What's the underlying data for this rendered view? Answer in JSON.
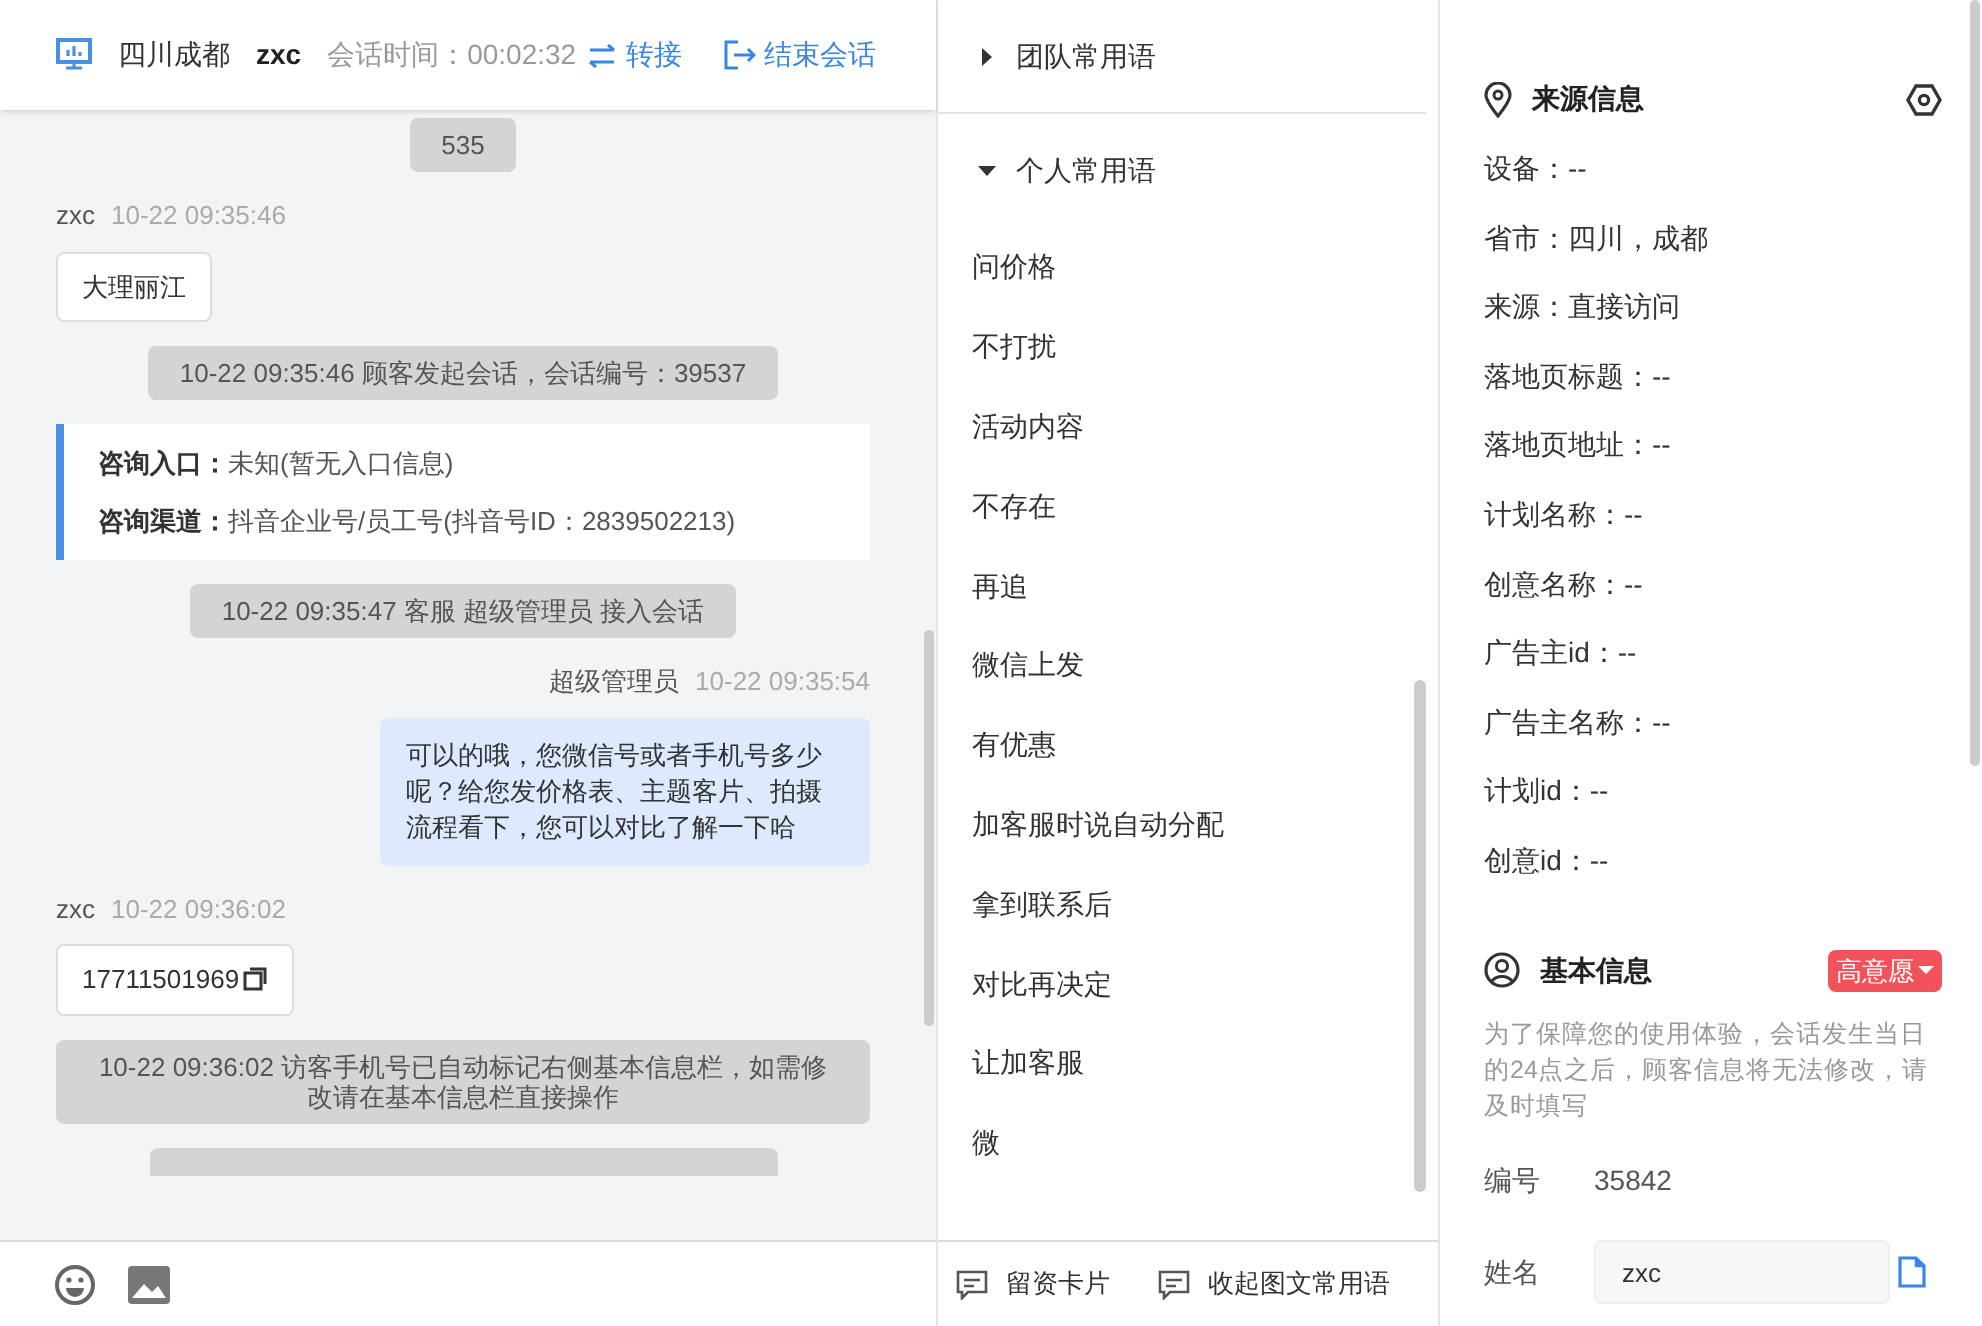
{
  "header": {
    "location": "四川成都",
    "user": "zxc",
    "session_time": "会话时间：00:02:32",
    "transfer": "转接",
    "end_session": "结束会话"
  },
  "messages": [
    {
      "kind": "system",
      "text": "535"
    },
    {
      "kind": "incoming",
      "sender": "zxc",
      "time": "10-22 09:35:46",
      "text": "大理丽江",
      "copyable": false
    },
    {
      "kind": "system",
      "text": "10-22 09:35:46 顾客发起会话，会话编号：39537"
    },
    {
      "kind": "info",
      "lines": [
        {
          "label": "咨询入口：",
          "value": "未知(暂无入口信息)"
        },
        {
          "label": "咨询渠道：",
          "value": "抖音企业号/员工号(抖音号ID：2839502213)"
        }
      ]
    },
    {
      "kind": "system",
      "text": "10-22 09:35:47 客服 超级管理员 接入会话"
    },
    {
      "kind": "outgoing",
      "sender": "超级管理员",
      "time": "10-22 09:35:54",
      "text": "可以的哦，您微信号或者手机号多少呢？给您发价格表、主题客片、拍摄流程看下，您可以对比了解一下哈"
    },
    {
      "kind": "incoming",
      "sender": "zxc",
      "time": "10-22 09:36:02",
      "text": "17711501969",
      "copyable": true
    },
    {
      "kind": "system",
      "text": "10-22 09:36:02 访客手机号已自动标记右侧基本信息栏，如需修改请在基本信息栏直接操作"
    },
    {
      "kind": "system"
    }
  ],
  "phrase_groups": [
    {
      "label": "团队常用语",
      "expanded": false
    },
    {
      "label": "个人常用语",
      "expanded": true,
      "items": [
        "问价格",
        "不打扰",
        "活动内容",
        "不存在",
        "再追",
        "微信上发",
        "有优惠",
        "加客服时说自动分配",
        "拿到联系后",
        "对比再决定",
        "让加客服",
        "微"
      ]
    }
  ],
  "phrase_footer": [
    "留资卡片",
    "收起图文常用语"
  ],
  "source_info": {
    "title": "来源信息",
    "fields": [
      "设备：--",
      "省市：四川，成都",
      "来源：直接访问",
      "落地页标题：--",
      "落地页地址：--",
      "计划名称：--",
      "创意名称：--",
      "广告主id：--",
      "广告主名称：--",
      "计划id：--",
      "创意id：--"
    ]
  },
  "basic_info": {
    "title": "基本信息",
    "intent_tag": "高意愿",
    "notice": "为了保障您的使用体验，会话发生当日的24点之后，顾客信息将无法修改，请及时填写",
    "fields": [
      {
        "kind": "text",
        "label": "编号",
        "value": "35842"
      },
      {
        "kind": "input",
        "label": "姓名",
        "value": "zxc"
      }
    ]
  }
}
